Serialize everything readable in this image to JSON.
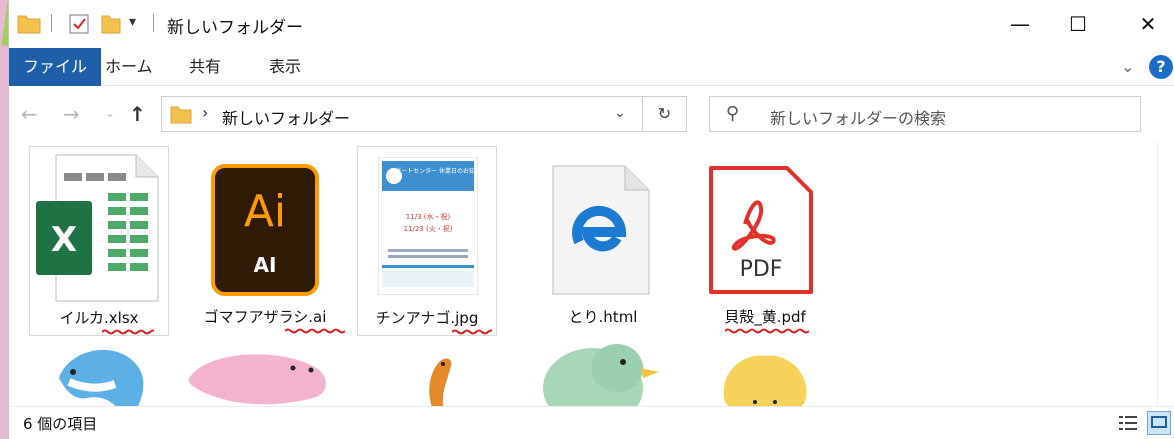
{
  "window": {
    "title": "新しいフォルダー",
    "controls": {
      "minimize": "—",
      "maximize": "☐",
      "close": "✕"
    }
  },
  "ribbon": {
    "tabs": [
      {
        "label": "ファイル",
        "active": true
      },
      {
        "label": "ホーム"
      },
      {
        "label": "共有"
      },
      {
        "label": "表示"
      }
    ],
    "help_label": "?"
  },
  "address_bar": {
    "path": "新しいフォルダー",
    "separator": "›",
    "search_placeholder": "新しいフォルダーの検索"
  },
  "files": [
    {
      "name": "イルカ.xlsx",
      "icon": "excel-file-icon"
    },
    {
      "name": "ゴマフアザラシ.ai",
      "icon": "illustrator-file-icon",
      "icon_text": "Ai",
      "sub_text": "AI"
    },
    {
      "name": "チンアナゴ.jpg",
      "icon": "jpg-thumbnail-icon",
      "thumb": {
        "header": "サポートセンター 休業日のお知らせ",
        "date1": "11/3 (水・祝)",
        "date2": "11/23 (火・祝)"
      }
    },
    {
      "name": "とり.html",
      "icon": "edge-html-file-icon"
    },
    {
      "name": "貝殻_黄.pdf",
      "icon": "pdf-file-icon",
      "sub_text": "PDF"
    }
  ],
  "status": {
    "item_count": "6 個の項目"
  },
  "colors": {
    "ribbon_active": "#1e5fa8",
    "frame_pink": "#e7b9d2",
    "excel_green": "#1f7244",
    "ai_orange": "#ff9a00",
    "ai_bg": "#2e1a05",
    "pdf_red": "#e0312a",
    "edge_blue": "#1b7bd2",
    "squiggle_red": "#d81e1e"
  }
}
